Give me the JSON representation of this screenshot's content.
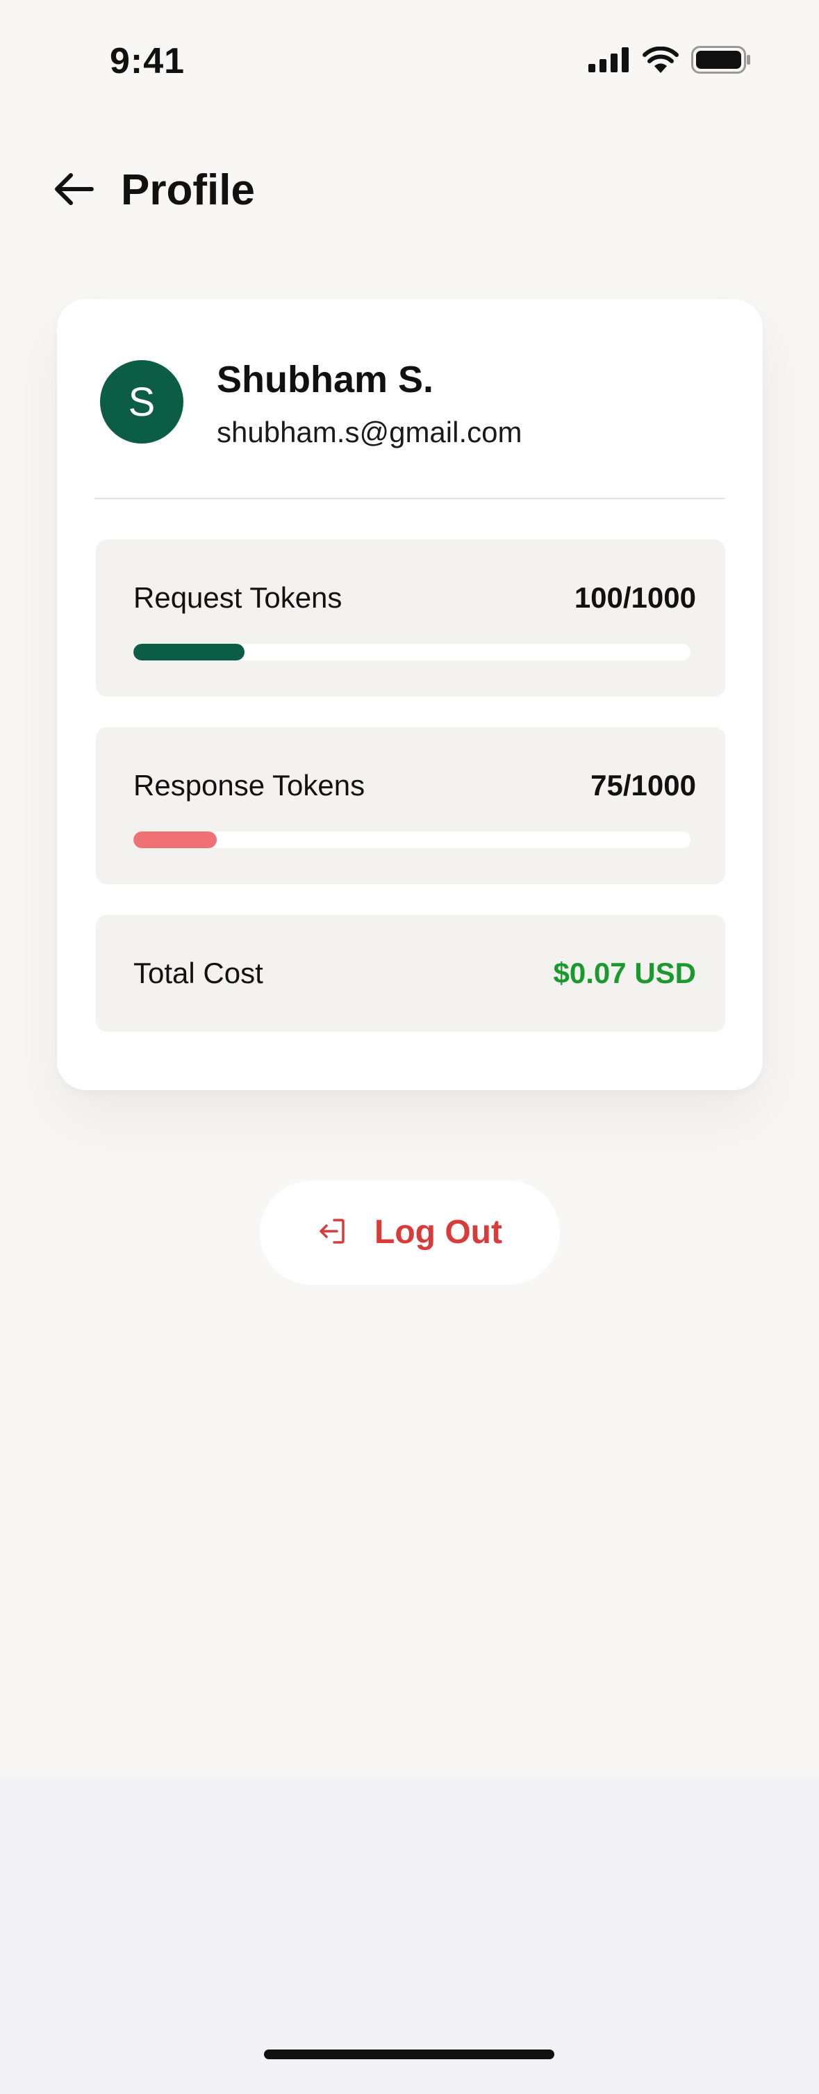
{
  "status_bar": {
    "time": "9:41",
    "icons": [
      "cellular-signal-icon",
      "wifi-icon",
      "battery-icon"
    ]
  },
  "header": {
    "back_icon": "arrow-left-icon",
    "title": "Profile"
  },
  "user": {
    "avatar_initial": "S",
    "avatar_color": "#0b5e45",
    "name": "Shubham S.",
    "email": "shubham.s@gmail.com"
  },
  "stats": {
    "request_tokens": {
      "label": "Request Tokens",
      "value": "100/1000",
      "used": 100,
      "limit": 1000,
      "bar_color": "#0b5e45"
    },
    "response_tokens": {
      "label": "Response Tokens",
      "value": "75/1000",
      "used": 75,
      "limit": 1000,
      "bar_color": "#ef7173"
    },
    "total_cost": {
      "label": "Total Cost",
      "value": "$0.07 USD",
      "value_color": "#1a9a2e"
    }
  },
  "logout": {
    "icon": "logout-icon",
    "label": "Log Out",
    "color": "#d93a3a"
  }
}
